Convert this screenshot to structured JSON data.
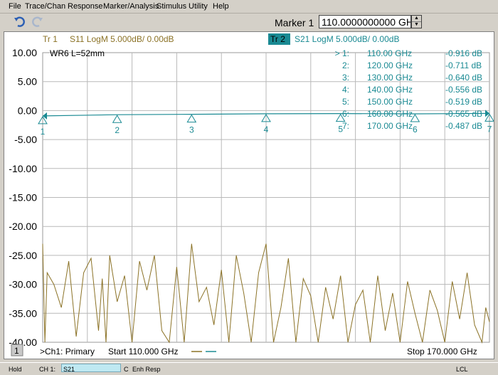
{
  "menu": [
    "File",
    "Trace/Chan",
    "Response",
    "Marker/Analysis",
    "Stimulus",
    "Utility",
    "Help"
  ],
  "toolbar": {
    "marker_label": "Marker 1",
    "marker_value": "110.0000000000 GH:"
  },
  "traces": [
    {
      "id": "tr1",
      "label": "Tr 1",
      "desc": "S11 LogM 5.000dB/  0.00dB",
      "color": "#8b7226"
    },
    {
      "id": "tr2",
      "label": "Tr 2",
      "desc": "S21 LogM 5.000dB/  0.00dB",
      "color": "#1a8a93"
    }
  ],
  "annotation": "WR6  L=52mm",
  "markers": [
    {
      "row": "> 1:",
      "freq": "110.00 GHz",
      "value": "-0.916 dB"
    },
    {
      "row": "2:",
      "freq": "120.00 GHz",
      "value": "-0.711 dB"
    },
    {
      "row": "3:",
      "freq": "130.00 GHz",
      "value": "-0.640 dB"
    },
    {
      "row": "4:",
      "freq": "140.00 GHz",
      "value": "-0.556 dB"
    },
    {
      "row": "5:",
      "freq": "150.00 GHz",
      "value": "-0.519 dB"
    },
    {
      "row": "6:",
      "freq": "160.00 GHz",
      "value": "-0.565 dB"
    },
    {
      "row": "7:",
      "freq": "170.00 GHz",
      "value": "-0.487 dB"
    }
  ],
  "marker_glyphs": [
    "1",
    "2",
    "3",
    "4",
    "5",
    "6",
    "7"
  ],
  "yaxis_labels": [
    "10.00",
    "5.00",
    "0.00",
    "-5.00",
    "-10.00",
    "-15.00",
    "-20.00",
    "-25.00",
    "-30.00",
    "-35.00",
    "-40.00"
  ],
  "footer": {
    "channel_num": "1",
    "channel_info": ">Ch1: Primary",
    "start": "Start  110.000 GHz",
    "stop": "Stop  170.000 GHz"
  },
  "status": {
    "hold": "Hold",
    "channel": "CH 1:",
    "trace": "S21",
    "c": "C",
    "mode": "Enh Resp",
    "lcl": "LCL"
  },
  "colors": {
    "s11": "#8b7226",
    "s21": "#1a8a93",
    "grid": "#b9b9b9"
  },
  "chart_data": {
    "type": "line",
    "x_range_ghz": [
      110,
      170
    ],
    "ylim": [
      -40,
      10
    ],
    "y_scale_db_per_div": 5,
    "grid": true,
    "series": [
      {
        "name": "S21",
        "x": [
          110,
          120,
          130,
          140,
          150,
          160,
          170
        ],
        "values": [
          -0.916,
          -0.711,
          -0.64,
          -0.556,
          -0.519,
          -0.565,
          -0.487
        ]
      },
      {
        "name": "S11",
        "x": [
          110.0,
          110.3,
          110.6,
          111.5,
          112.5,
          113.5,
          114.5,
          115.5,
          116.5,
          117.5,
          118.0,
          118.5,
          119.0,
          120.0,
          121.0,
          122.0,
          123.0,
          124.0,
          125.0,
          126.0,
          127.0,
          128.0,
          129.0,
          130.0,
          131.0,
          132.0,
          133.0,
          134.0,
          135.0,
          136.0,
          137.0,
          138.0,
          139.0,
          140.0,
          141.0,
          142.0,
          143.0,
          144.0,
          145.0,
          146.0,
          147.0,
          148.0,
          149.0,
          150.0,
          151.0,
          152.0,
          153.0,
          154.0,
          155.0,
          156.0,
          157.0,
          158.0,
          159.0,
          160.0,
          161.0,
          162.0,
          163.0,
          164.0,
          165.0,
          166.0,
          167.0,
          168.0,
          169.0,
          169.5,
          170.0
        ],
        "values": [
          -23.0,
          -40.0,
          -28.0,
          -30.0,
          -34.0,
          -26.0,
          -39.0,
          -28.0,
          -25.5,
          -38.0,
          -29.0,
          -40.0,
          -25.0,
          -33.0,
          -28.5,
          -40.0,
          -26.0,
          -31.0,
          -25.0,
          -38.0,
          -40.0,
          -27.0,
          -40.0,
          -23.0,
          -33.0,
          -30.5,
          -37.0,
          -27.5,
          -40.0,
          -25.0,
          -31.5,
          -40.0,
          -28.0,
          -23.0,
          -40.0,
          -34.0,
          -25.5,
          -40.0,
          -29.0,
          -32.0,
          -40.0,
          -30.5,
          -36.0,
          -28.5,
          -40.0,
          -33.5,
          -31.0,
          -40.0,
          -28.5,
          -38.0,
          -31.5,
          -40.0,
          -29.5,
          -35.0,
          -40.0,
          -31.0,
          -34.5,
          -40.0,
          -29.5,
          -36.0,
          -28.0,
          -37.0,
          -40.0,
          -34.0,
          -36.5
        ]
      }
    ]
  }
}
